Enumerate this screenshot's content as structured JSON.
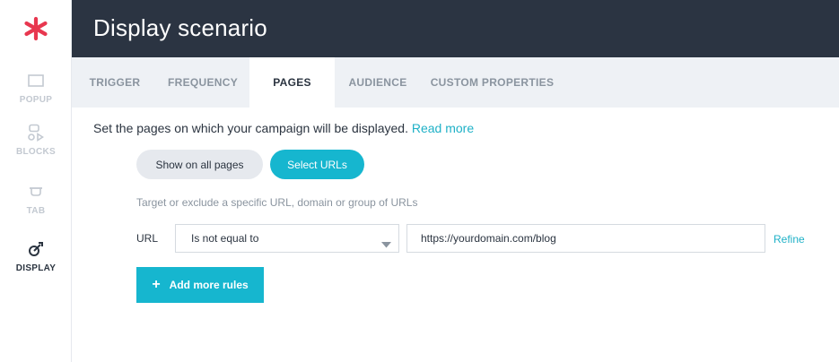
{
  "header": {
    "title": "Display scenario"
  },
  "sidebar": {
    "items": [
      {
        "label": "POPUP",
        "icon": "popup-icon"
      },
      {
        "label": "BLOCKS",
        "icon": "blocks-icon"
      },
      {
        "label": "TAB",
        "icon": "tab-icon"
      },
      {
        "label": "DISPLAY",
        "icon": "display-icon",
        "active": true
      }
    ]
  },
  "tabs": [
    {
      "label": "TRIGGER"
    },
    {
      "label": "FREQUENCY"
    },
    {
      "label": "PAGES",
      "active": true
    },
    {
      "label": "AUDIENCE"
    },
    {
      "label": "CUSTOM PROPERTIES"
    }
  ],
  "pages": {
    "description": "Set the pages on which your campaign will be displayed.",
    "read_more": "Read more",
    "show_all_label": "Show on all pages",
    "select_urls_label": "Select URLs",
    "hint": "Target or exclude a specific URL, domain or group of URLs",
    "rule": {
      "label": "URL",
      "operator": "Is not equal to",
      "value": "https://yourdomain.com/blog",
      "refine": "Refine"
    },
    "add_more": "Add more rules"
  },
  "colors": {
    "brand": "#e8374f",
    "accent": "#16b6cf",
    "header_bg": "#2b3442",
    "tabs_bg": "#eef1f5"
  }
}
